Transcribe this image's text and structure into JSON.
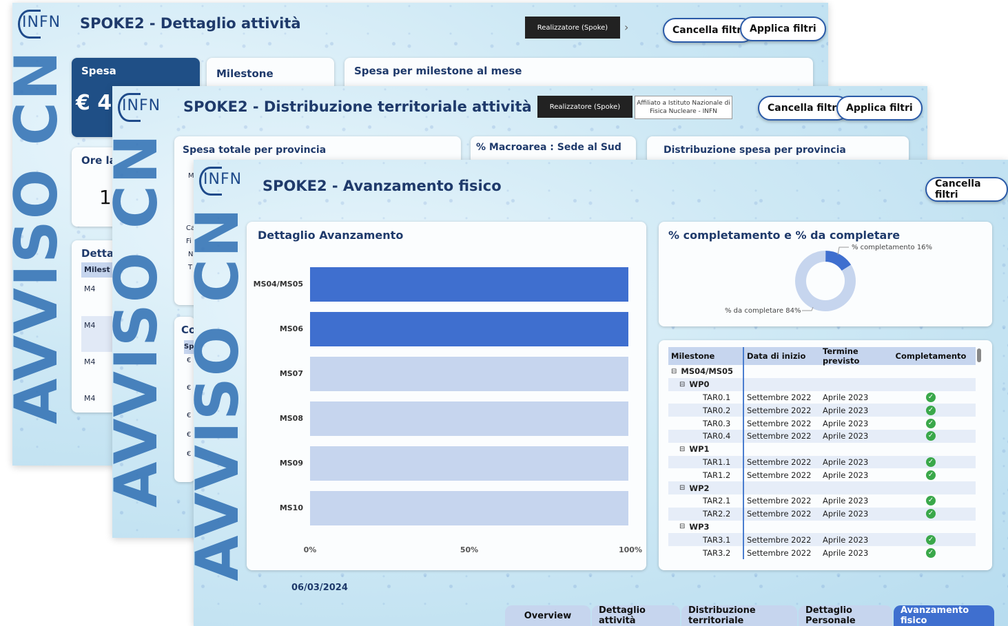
{
  "page1": {
    "logo": "INFN",
    "title": "SPOKE2 - Dettaglio attività",
    "slicer": "Realizzatore (Spoke)",
    "btn_clear": "Cancella filtri",
    "btn_apply": "Applica filtri",
    "watermark": "AVVISO CN",
    "card_spesa_title": "Spesa",
    "card_spesa_value": "€ 4.",
    "card_milestone_title": "Milestone",
    "card_chart_title": "Spesa per milestone al mese",
    "card_ore_title": "Ore la",
    "card_ore_value": "1",
    "card_detail_title": "Detta",
    "card_detail_col": "Milest",
    "detail_rows": [
      "M4",
      "M4",
      "M4",
      "M4"
    ]
  },
  "page2": {
    "logo": "INFN",
    "title": "SPOKE2 - Distribuzione territoriale attività",
    "slicer": "Realizzatore (Spoke)",
    "slicer_value": "Affiliato a Istituto Nazionale di Fisica Nucleare - INFN",
    "btn_clear": "Cancella filtri",
    "btn_apply": "Applica filtri",
    "watermark": "AVVISO CN",
    "card_prov_title": "Spesa totale per provincia",
    "card_macro_title": "% Macroarea : Sede al Sud",
    "card_dist_title": "Distribuzione spesa per provincia",
    "left_fragments": [
      "M",
      "Ca",
      "Fi",
      "N",
      "T"
    ],
    "card_co_title": "Co",
    "card_co_col": "Sp",
    "co_rows": [
      "€",
      "€",
      "€",
      "€",
      "€"
    ]
  },
  "page3": {
    "logo": "INFN",
    "title": "SPOKE2 - Avanzamento fisico",
    "btn_clear": "Cancella filtri",
    "watermark": "AVVISO CN",
    "date": "06/03/2024",
    "bar_card_title": "Dettaglio Avanzamento",
    "donut_card_title": "% completamento e % da completare",
    "table": {
      "headers": [
        "Milestone",
        "Data di inizio",
        "Termine previsto",
        "Completamento"
      ],
      "rows": [
        {
          "label": "MS04/MS05",
          "level": 0,
          "group": true,
          "start": "",
          "end": "",
          "done": false
        },
        {
          "label": "WP0",
          "level": 1,
          "group": true,
          "start": "",
          "end": "",
          "done": false
        },
        {
          "label": "TAR0.1",
          "level": 2,
          "group": false,
          "start": "Settembre 2022",
          "end": "Aprile 2023",
          "done": true
        },
        {
          "label": "TAR0.2",
          "level": 2,
          "group": false,
          "start": "Settembre 2022",
          "end": "Aprile 2023",
          "done": true
        },
        {
          "label": "TAR0.3",
          "level": 2,
          "group": false,
          "start": "Settembre 2022",
          "end": "Aprile 2023",
          "done": true
        },
        {
          "label": "TAR0.4",
          "level": 2,
          "group": false,
          "start": "Settembre 2022",
          "end": "Aprile 2023",
          "done": true
        },
        {
          "label": "WP1",
          "level": 1,
          "group": true,
          "start": "",
          "end": "",
          "done": false
        },
        {
          "label": "TAR1.1",
          "level": 2,
          "group": false,
          "start": "Settembre 2022",
          "end": "Aprile 2023",
          "done": true
        },
        {
          "label": "TAR1.2",
          "level": 2,
          "group": false,
          "start": "Settembre 2022",
          "end": "Aprile 2023",
          "done": true
        },
        {
          "label": "WP2",
          "level": 1,
          "group": true,
          "start": "",
          "end": "",
          "done": false
        },
        {
          "label": "TAR2.1",
          "level": 2,
          "group": false,
          "start": "Settembre 2022",
          "end": "Aprile 2023",
          "done": true
        },
        {
          "label": "TAR2.2",
          "level": 2,
          "group": false,
          "start": "Settembre 2022",
          "end": "Aprile 2023",
          "done": true
        },
        {
          "label": "WP3",
          "level": 1,
          "group": true,
          "start": "",
          "end": "",
          "done": false
        },
        {
          "label": "TAR3.1",
          "level": 2,
          "group": false,
          "start": "Settembre 2022",
          "end": "Aprile 2023",
          "done": true
        },
        {
          "label": "TAR3.2",
          "level": 2,
          "group": false,
          "start": "Settembre 2022",
          "end": "Aprile 2023",
          "done": true
        }
      ]
    },
    "nav_tabs": [
      "Overview",
      "Dettaglio attività",
      "Distribuzione territoriale",
      "Dettaglio Personale",
      "Avanzamento fisico"
    ],
    "active_tab": "Avanzamento fisico"
  },
  "chart_data": [
    {
      "type": "bar",
      "orientation": "horizontal",
      "title": "Dettaglio Avanzamento",
      "categories": [
        "MS04/MS05",
        "MS06",
        "MS07",
        "MS08",
        "MS09",
        "MS10"
      ],
      "values": [
        100,
        100,
        0,
        0,
        0,
        0
      ],
      "xlim": [
        0,
        100
      ],
      "xticks": [
        "0%",
        "50%",
        "100%"
      ],
      "colors": {
        "fill": "#3f6fcf",
        "background": "#c6d5ee"
      }
    },
    {
      "type": "pie",
      "variant": "donut",
      "title": "% completamento e % da completare",
      "labels": [
        "% completamento",
        "% da completare"
      ],
      "values": [
        16,
        84
      ],
      "data_labels": [
        "% completamento 16%",
        "% da completare 84%"
      ],
      "colors": [
        "#3f6fcf",
        "#c6d5ee"
      ]
    }
  ]
}
